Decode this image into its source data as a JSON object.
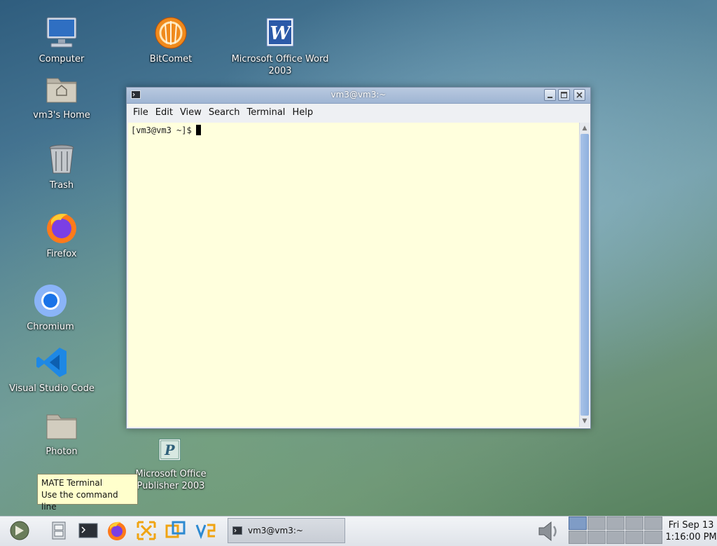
{
  "desktop": {
    "icons": [
      {
        "label": "Computer"
      },
      {
        "label": "BitComet"
      },
      {
        "label": "Microsoft Office Word 2003"
      },
      {
        "label": "vm3's Home"
      },
      {
        "label": "Trash"
      },
      {
        "label": "Firefox"
      },
      {
        "label": "Chromium"
      },
      {
        "label": "Visual Studio Code"
      },
      {
        "label": "Photon"
      },
      {
        "label": "Microsoft Office Publisher 2003"
      }
    ]
  },
  "window": {
    "title": "vm3@vm3:~",
    "menu": [
      "File",
      "Edit",
      "View",
      "Search",
      "Terminal",
      "Help"
    ],
    "prompt": "[vm3@vm3 ~]$"
  },
  "tooltip": {
    "line1": "MATE Terminal",
    "line2": "Use the command line"
  },
  "taskbar": {
    "task_label": "vm3@vm3:~",
    "clock_date": "Fri Sep 13",
    "clock_time": "1:16:00 PM"
  },
  "colors": {
    "terminal_bg": "#ffffdd",
    "titlebar": "#a9bedb",
    "tooltip_bg": "#ffffcc"
  }
}
